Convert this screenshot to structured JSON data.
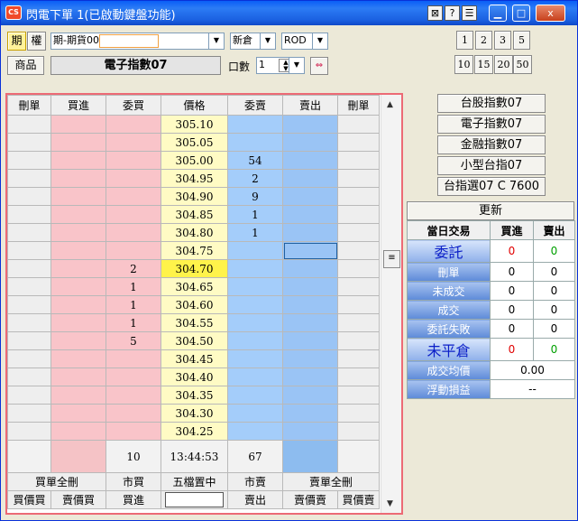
{
  "window": {
    "icon_text": "CS",
    "title": "閃電下單 1(已啟動鍵盤功能)",
    "help_label": "?",
    "close_label": "x"
  },
  "controls": {
    "mode_futures": "期",
    "mode_options": "權",
    "contract_select": "期-期貨00",
    "order_type": "新倉",
    "time_in_force": "ROD",
    "product_button": "商品",
    "product_name": "電子指數07",
    "qty_label": "口數",
    "qty_value": "1"
  },
  "quick_qty_row1": [
    "1",
    "2",
    "3",
    "5"
  ],
  "quick_qty_row2": [
    "10",
    "15",
    "20",
    "50"
  ],
  "ladder": {
    "headers": [
      "刪單",
      "買進",
      "委買",
      "價格",
      "委賣",
      "賣出",
      "刪單"
    ],
    "rows": [
      {
        "bid": "",
        "price": "305.10",
        "ask": ""
      },
      {
        "bid": "",
        "price": "305.05",
        "ask": ""
      },
      {
        "bid": "",
        "price": "305.00",
        "ask": "54"
      },
      {
        "bid": "",
        "price": "304.95",
        "ask": "2"
      },
      {
        "bid": "",
        "price": "304.90",
        "ask": "9"
      },
      {
        "bid": "",
        "price": "304.85",
        "ask": "1"
      },
      {
        "bid": "",
        "price": "304.80",
        "ask": "1"
      },
      {
        "bid": "",
        "price": "304.75",
        "ask": ""
      },
      {
        "bid": "2",
        "price": "304.70",
        "ask": ""
      },
      {
        "bid": "1",
        "price": "304.65",
        "ask": ""
      },
      {
        "bid": "1",
        "price": "304.60",
        "ask": ""
      },
      {
        "bid": "1",
        "price": "304.55",
        "ask": ""
      },
      {
        "bid": "5",
        "price": "304.50",
        "ask": ""
      },
      {
        "bid": "",
        "price": "304.45",
        "ask": ""
      },
      {
        "bid": "",
        "price": "304.40",
        "ask": ""
      },
      {
        "bid": "",
        "price": "304.35",
        "ask": ""
      },
      {
        "bid": "",
        "price": "304.30",
        "ask": ""
      },
      {
        "bid": "",
        "price": "304.25",
        "ask": ""
      }
    ],
    "footer": {
      "bid_total": "10",
      "time": "13:44:53",
      "ask_total": "67"
    },
    "actions1": {
      "cancel_all_buy": "買單全刪",
      "market_buy": "市買",
      "center": "五檔置中",
      "market_sell": "市賣",
      "cancel_all_sell": "賣單全刪"
    },
    "actions2": {
      "buy_bid": "買價買",
      "sell_bid": "賣價買",
      "buy": "買進",
      "sell": "賣出",
      "buy_ask": "賣價賣",
      "sell_ask": "買價賣"
    }
  },
  "quick_products": [
    "台股指數07",
    "電子指數07",
    "金融指數07",
    "小型台指07",
    "台指選07 C 7600"
  ],
  "stats": {
    "update": "更新",
    "header": [
      "當日交易",
      "買進",
      "賣出"
    ],
    "rows": [
      {
        "label": "委託",
        "buy": "0",
        "sell": "0"
      },
      {
        "label": "刪單",
        "buy": "0",
        "sell": "0"
      },
      {
        "label": "未成交",
        "buy": "0",
        "sell": "0"
      },
      {
        "label": "成交",
        "buy": "0",
        "sell": "0"
      },
      {
        "label": "委託失敗",
        "buy": "0",
        "sell": "0"
      },
      {
        "label": "未平倉",
        "buy": "0",
        "sell": "0"
      }
    ],
    "avg_label": "成交均價",
    "avg_value": "0.00",
    "pnl_label": "浮動損益",
    "pnl_value": "--"
  }
}
